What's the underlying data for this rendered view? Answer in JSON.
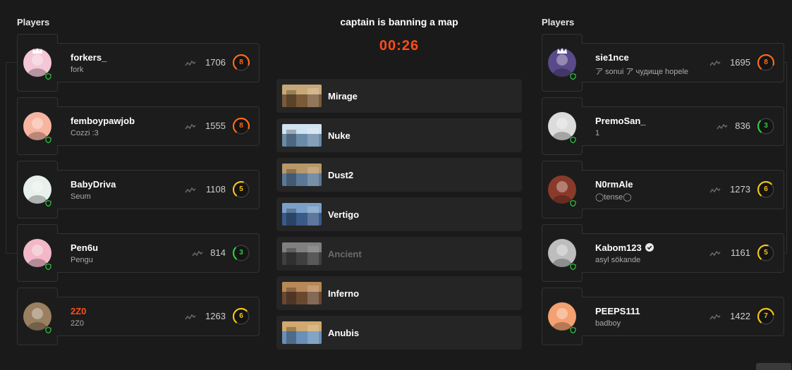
{
  "left_team": {
    "title": "Players",
    "players": [
      {
        "name": "forkers_",
        "sub": "fork",
        "elo": "1706",
        "level": "8",
        "level_color": "#ff6a1a",
        "captain": true,
        "name_color": "#ffffff",
        "avatar_color": "#f4c6d6"
      },
      {
        "name": "femboypawjob",
        "sub": "Cozzi :3",
        "elo": "1555",
        "level": "8",
        "level_color": "#ff6a1a",
        "captain": false,
        "name_color": "#ffffff",
        "avatar_color": "#f7b5a0"
      },
      {
        "name": "BabyDriva",
        "sub": "Seum",
        "elo": "1108",
        "level": "5",
        "level_color": "#f5c518",
        "captain": false,
        "name_color": "#ffffff",
        "avatar_color": "#e8f0ec"
      },
      {
        "name": "Pen6u",
        "sub": "Pengu",
        "elo": "814",
        "level": "3",
        "level_color": "#2ecc40",
        "captain": false,
        "name_color": "#ffffff",
        "avatar_color": "#f2b8c8"
      },
      {
        "name": "2Z0",
        "sub": "2Z0",
        "elo": "1263",
        "level": "6",
        "level_color": "#f5c518",
        "captain": false,
        "name_color": "#ff4d1a",
        "avatar_color": "#9a8060"
      }
    ]
  },
  "right_team": {
    "title": "Players",
    "players": [
      {
        "name": "sie1nce",
        "sub": "ア sonui ア чудище hopele",
        "elo": "1695",
        "level": "8",
        "level_color": "#ff6a1a",
        "captain": true,
        "name_color": "#ffffff",
        "avatar_color": "#5a4a8a"
      },
      {
        "name": "PremoSan_",
        "sub": "1",
        "elo": "836",
        "level": "3",
        "level_color": "#2ecc40",
        "captain": false,
        "name_color": "#ffffff",
        "avatar_color": "#dcdcdc"
      },
      {
        "name": "N0rmAle",
        "sub": "◯tense◯",
        "elo": "1273",
        "level": "6",
        "level_color": "#f5c518",
        "captain": false,
        "name_color": "#ffffff",
        "avatar_color": "#8a3a2a"
      },
      {
        "name": "Kabom123",
        "sub": "asyl sökande",
        "elo": "1161",
        "level": "5",
        "level_color": "#f5c518",
        "captain": false,
        "verified": true,
        "name_color": "#ffffff",
        "avatar_color": "#bdbdbd"
      },
      {
        "name": "PEEPS111",
        "sub": "badboy",
        "elo": "1422",
        "level": "7",
        "level_color": "#f5c518",
        "captain": false,
        "name_color": "#ffffff",
        "avatar_color": "#f4a070"
      }
    ]
  },
  "veto": {
    "status": "captain is banning a map",
    "timer": "00:26",
    "maps": [
      {
        "name": "Mirage",
        "banned": false,
        "color_a": "#c8a878",
        "color_b": "#7a5a38"
      },
      {
        "name": "Nuke",
        "banned": false,
        "color_a": "#cfe2f0",
        "color_b": "#6a8aa8"
      },
      {
        "name": "Dust2",
        "banned": false,
        "color_a": "#b89868",
        "color_b": "#5a7898"
      },
      {
        "name": "Vertigo",
        "banned": false,
        "color_a": "#7aa0c8",
        "color_b": "#3a5a88"
      },
      {
        "name": "Ancient",
        "banned": true,
        "color_a": "#a0a0a0",
        "color_b": "#505050"
      },
      {
        "name": "Inferno",
        "banned": false,
        "color_a": "#b88858",
        "color_b": "#6a4830"
      },
      {
        "name": "Anubis",
        "banned": false,
        "color_a": "#d0a870",
        "color_b": "#6890b8"
      }
    ]
  },
  "colors": {
    "accent": "#ff4d1a",
    "background": "#1a1a1a",
    "card": "#1c1c1c",
    "shield": "#2ecc40"
  },
  "icons": {
    "captain": "crown-icon",
    "anticheat": "shield-icon",
    "verified": "verified-badge-icon",
    "elo_trend": "trend-icon"
  }
}
